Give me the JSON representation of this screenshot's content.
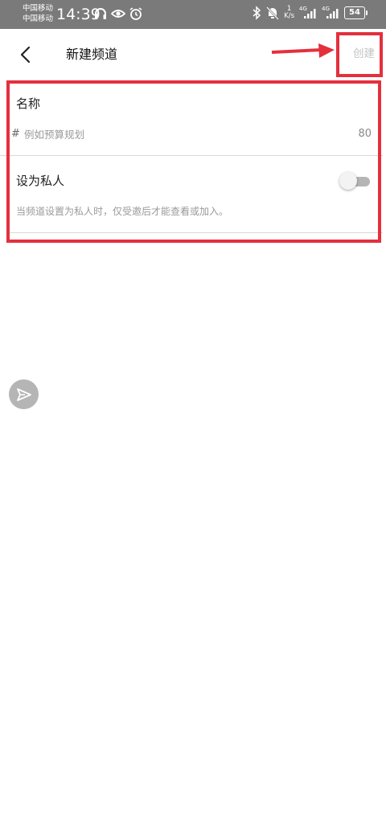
{
  "status_bar": {
    "carrier1": "中国移动",
    "carrier2": "中国移动",
    "time": "14:39",
    "net_speed_value": "1",
    "net_speed_unit": "K/s",
    "sim1_type": "4G",
    "sim2_type": "4G",
    "battery": "54"
  },
  "header": {
    "title": "新建频道",
    "create_label": "创建"
  },
  "form": {
    "name_label": "名称",
    "name_prefix": "#",
    "name_placeholder": "例如预算规划",
    "name_value": "",
    "name_char_limit": "80",
    "private_label": "设为私人",
    "private_enabled": false,
    "private_description": "当频道设置为私人时，仅受邀后才能查看或加入。"
  },
  "colors": {
    "annotation": "#e4303d",
    "status_bar_bg": "#7a7a7a",
    "create_disabled": "#c3c3c3"
  },
  "icons": {
    "back": "chevron-left-icon",
    "floating": "send-icon"
  }
}
